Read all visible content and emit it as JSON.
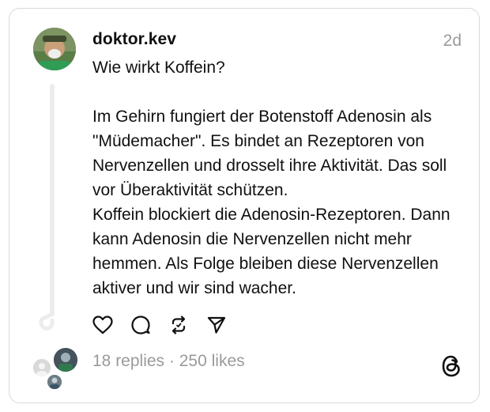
{
  "post": {
    "username": "doktor.kev",
    "time": "2d",
    "lines": [
      "Wie wirkt Koffein?",
      "",
      "Im Gehirn fungiert der Botenstoff Adenosin als \"Müdemacher\". Es bindet an Rezeptoren von Nervenzellen und drosselt ihre Aktivität. Das soll vor Überaktivität schützen.",
      "Koffein blockiert die Adenosin-Rezeptoren. Dann kann Adenosin die Nervenzellen nicht mehr hemmen. Als Folge bleiben diese Nervenzellen aktiver und wir sind wacher."
    ],
    "replies": "18 replies",
    "separator": " · ",
    "likes": "250 likes"
  },
  "icons": {
    "like": "heart-icon",
    "reply": "comment-icon",
    "repost": "repost-icon",
    "share": "send-icon",
    "brand": "threads-logo-icon"
  },
  "colors": {
    "text": "#101010",
    "muted": "#9a9a9a",
    "border": "#d9d9d9"
  }
}
